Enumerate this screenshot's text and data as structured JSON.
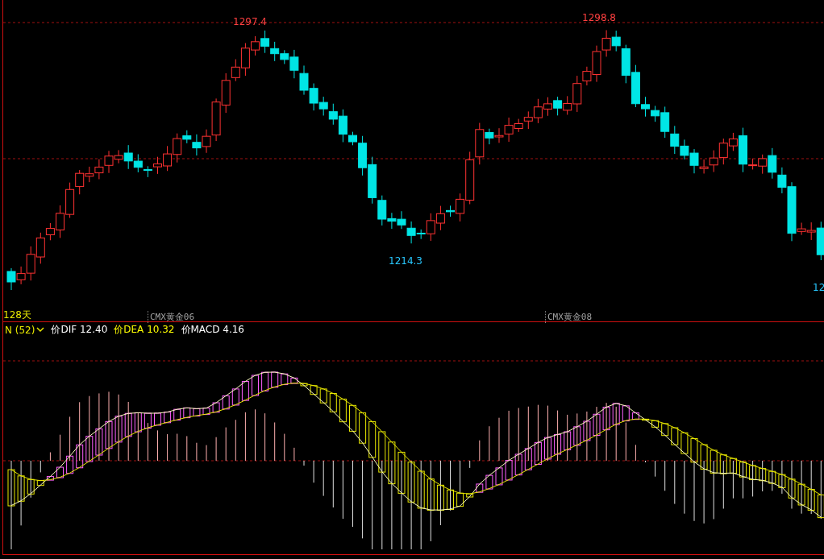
{
  "price_panel": {
    "period": "128天",
    "extreme_labels": [
      {
        "text": "1297.4",
        "kind": "high"
      },
      {
        "text": "1298.8",
        "kind": "high"
      },
      {
        "text": "1214.3",
        "kind": "low"
      },
      {
        "text": "12",
        "kind": "low"
      }
    ],
    "contract_labels": [
      "CMX黄金06",
      "CMX黄金08"
    ]
  },
  "indicator_panel": {
    "parameter": "N (52)",
    "legend": [
      {
        "text": "价DIF 12.40",
        "color": "#ffffff"
      },
      {
        "text": "价DEA 10.32",
        "color": "#ffff00"
      },
      {
        "text": "价MACD 4.16",
        "color": "#ffffff"
      }
    ]
  }
}
